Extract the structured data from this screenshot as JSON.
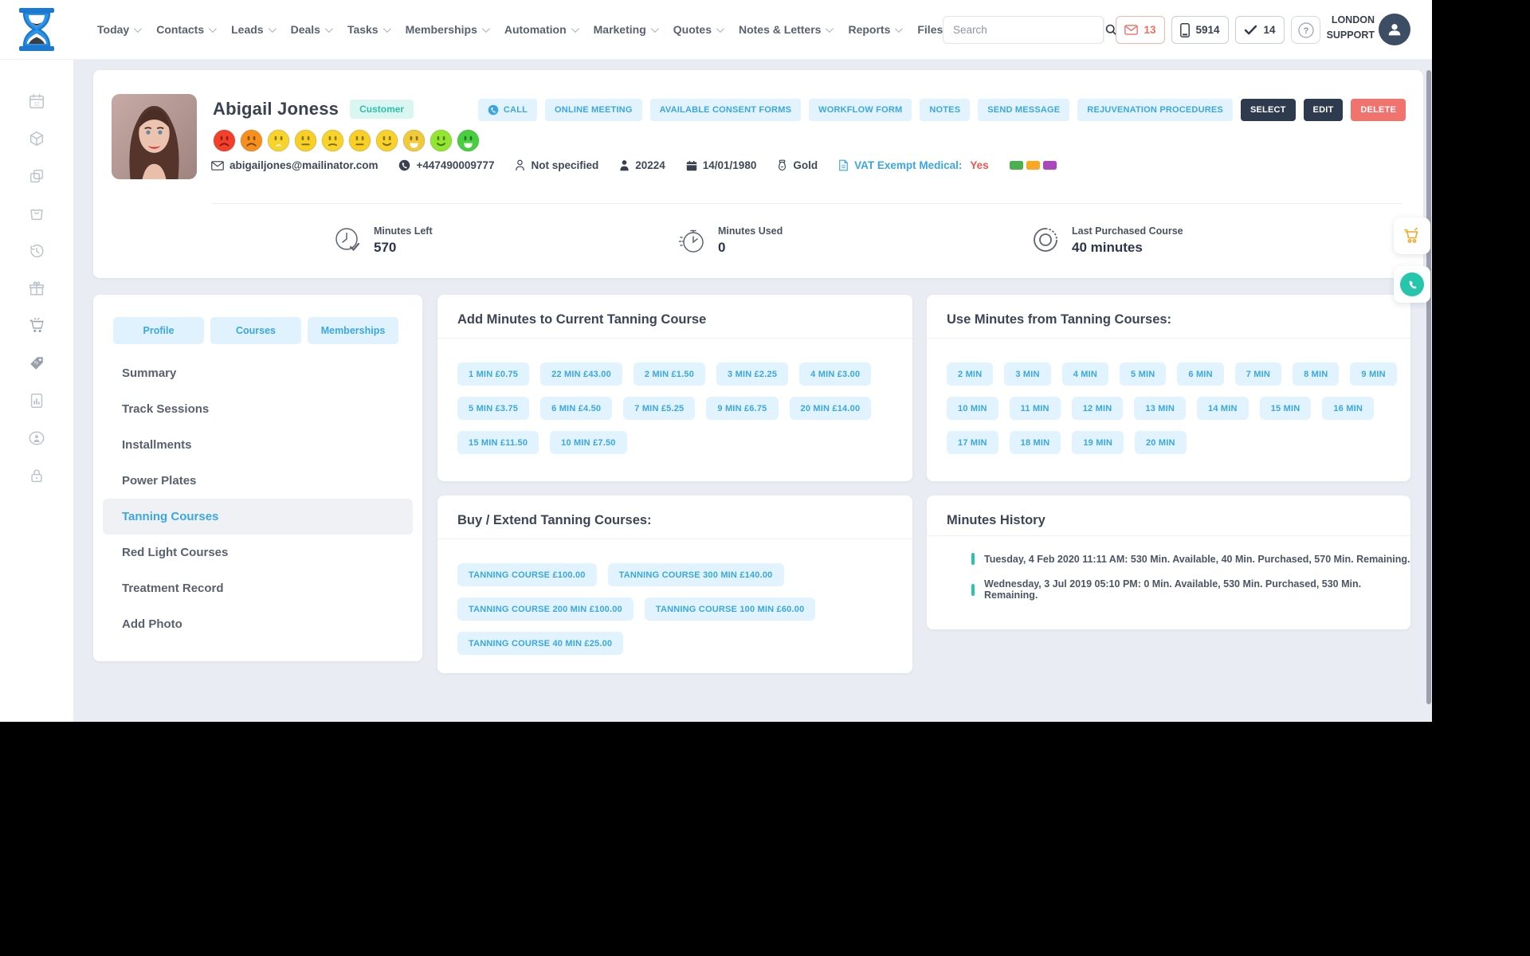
{
  "header": {
    "nav": [
      {
        "label": "Today"
      },
      {
        "label": "Contacts"
      },
      {
        "label": "Leads"
      },
      {
        "label": "Deals"
      },
      {
        "label": "Tasks"
      },
      {
        "label": "Memberships"
      },
      {
        "label": "Automation"
      },
      {
        "label": "Marketing"
      },
      {
        "label": "Quotes"
      },
      {
        "label": "Notes & Letters"
      },
      {
        "label": "Reports"
      },
      {
        "label": "Files"
      }
    ],
    "search": {
      "placeholder": "Search"
    },
    "badges": {
      "messages": "13",
      "phone": "5914",
      "tasks": "14",
      "help": "?"
    },
    "account": {
      "line1": "LONDON",
      "line2": "SUPPORT"
    }
  },
  "sidebar_icons": [
    "calendar-icon",
    "package-icon",
    "copy-icon",
    "shopping-bag-icon",
    "history-icon",
    "gift-icon",
    "cart-icon",
    "price-tag-icon",
    "report-icon",
    "user-circle-icon",
    "lock-icon"
  ],
  "profile": {
    "name": "Abigail Joness",
    "type_badge": "Customer",
    "email": "abigailjones@mailinator.com",
    "phone": "+447490009777",
    "gender": "Not specified",
    "customer_id": "20224",
    "dob": "14/01/1980",
    "tier": "Gold",
    "vat_label": "VAT Exempt Medical:",
    "vat_value": "Yes",
    "tag_colors": [
      "#4caf50",
      "#f9a825",
      "#ab47bc"
    ],
    "mood_scale": [
      {
        "name": "mood-1",
        "color": "#f4402a",
        "mouth": "frown"
      },
      {
        "name": "mood-2",
        "color": "#f78f1e",
        "mouth": "frown"
      },
      {
        "name": "mood-3",
        "color": "#f8d42a",
        "mouth": "open-frown"
      },
      {
        "name": "mood-4",
        "color": "#f8cf25",
        "mouth": "neutral"
      },
      {
        "name": "mood-5",
        "color": "#f8d42a",
        "mouth": "slight-frown"
      },
      {
        "name": "mood-6",
        "color": "#f8cf25",
        "mouth": "neutral"
      },
      {
        "name": "mood-7",
        "color": "#f8d22a",
        "mouth": "smile"
      },
      {
        "name": "mood-8",
        "color": "#f0ca39",
        "mouth": "open-smile"
      },
      {
        "name": "mood-9",
        "color": "#93e62f",
        "mouth": "smile"
      },
      {
        "name": "mood-10",
        "color": "#47cf3f",
        "mouth": "open-smile"
      }
    ],
    "actions": {
      "call": "CALL",
      "online_meeting": "ONLINE MEETING",
      "consent_forms": "AVAILABLE CONSENT FORMS",
      "workflow_form": "WORKFLOW FORM",
      "notes": "NOTES",
      "send_message": "SEND MESSAGE",
      "rejuvenation": "REJUVENATION PROCEDURES",
      "select": "SELECT",
      "edit": "EDIT",
      "delete": "DELETE"
    },
    "stats": [
      {
        "label": "Minutes Left",
        "value": "570"
      },
      {
        "label": "Minutes Used",
        "value": "0"
      },
      {
        "label": "Last Purchased Course",
        "value": "40 minutes"
      }
    ]
  },
  "left_panel": {
    "tabs": [
      "Profile",
      "Courses",
      "Memberships"
    ],
    "menu": [
      "Summary",
      "Track Sessions",
      "Installments",
      "Power Plates",
      "Tanning Courses",
      "Red Light Courses",
      "Treatment Record",
      "Add Photo"
    ],
    "active_item": "Tanning Courses"
  },
  "panels": {
    "add_minutes": {
      "title": "Add Minutes to Current Tanning Course",
      "rows": [
        [
          "1 MIN £0.75",
          "22 MIN £43.00",
          "2 MIN £1.50",
          "3 MIN £2.25",
          "4 MIN £3.00"
        ],
        [
          "5 MIN £3.75",
          "6 MIN £4.50",
          "7 MIN £5.25",
          "9 MIN £6.75",
          "20 MIN £14.00"
        ],
        [
          "15 MIN £11.50",
          "10 MIN £7.50"
        ]
      ]
    },
    "use_minutes": {
      "title": "Use Minutes from Tanning Courses:",
      "rows": [
        [
          "2 MIN",
          "3 MIN",
          "4 MIN",
          "5 MIN",
          "6 MIN",
          "7 MIN",
          "8 MIN",
          "9 MIN"
        ],
        [
          "10 MIN",
          "11 MIN",
          "12 MIN",
          "13 MIN",
          "14 MIN",
          "15 MIN",
          "16 MIN"
        ],
        [
          "17 MIN",
          "18 MIN",
          "19 MIN",
          "20 MIN"
        ]
      ]
    },
    "buy_courses": {
      "title": "Buy / Extend Tanning Courses:",
      "rows": [
        [
          "TANNING COURSE £100.00",
          "TANNING COURSE 300 MIN £140.00"
        ],
        [
          "TANNING COURSE 200 MIN £100.00",
          "TANNING COURSE 100 MIN £60.00"
        ],
        [
          "TANNING COURSE 40 MIN £25.00"
        ]
      ]
    },
    "history": {
      "title": "Minutes History",
      "entries": [
        "Tuesday, 4 Feb 2020 11:11 AM: 530 Min. Available, 40 Min. Purchased, 570 Min. Remaining.",
        "Wednesday, 3 Jul 2019 05:10 PM: 0 Min. Available, 530 Min. Purchased, 530 Min. Remaining."
      ]
    }
  },
  "floating_icons": [
    "cart-icon",
    "whatsapp-phone-icon"
  ],
  "colors": {
    "accent_blue": "#3aa7e0",
    "pill_bg": "#e1f3fe",
    "dark_button": "#2e3b4f",
    "delete_red": "#f0736e",
    "teal_badge": "#2fc0ab",
    "history_marker": "#2bc4a9"
  }
}
